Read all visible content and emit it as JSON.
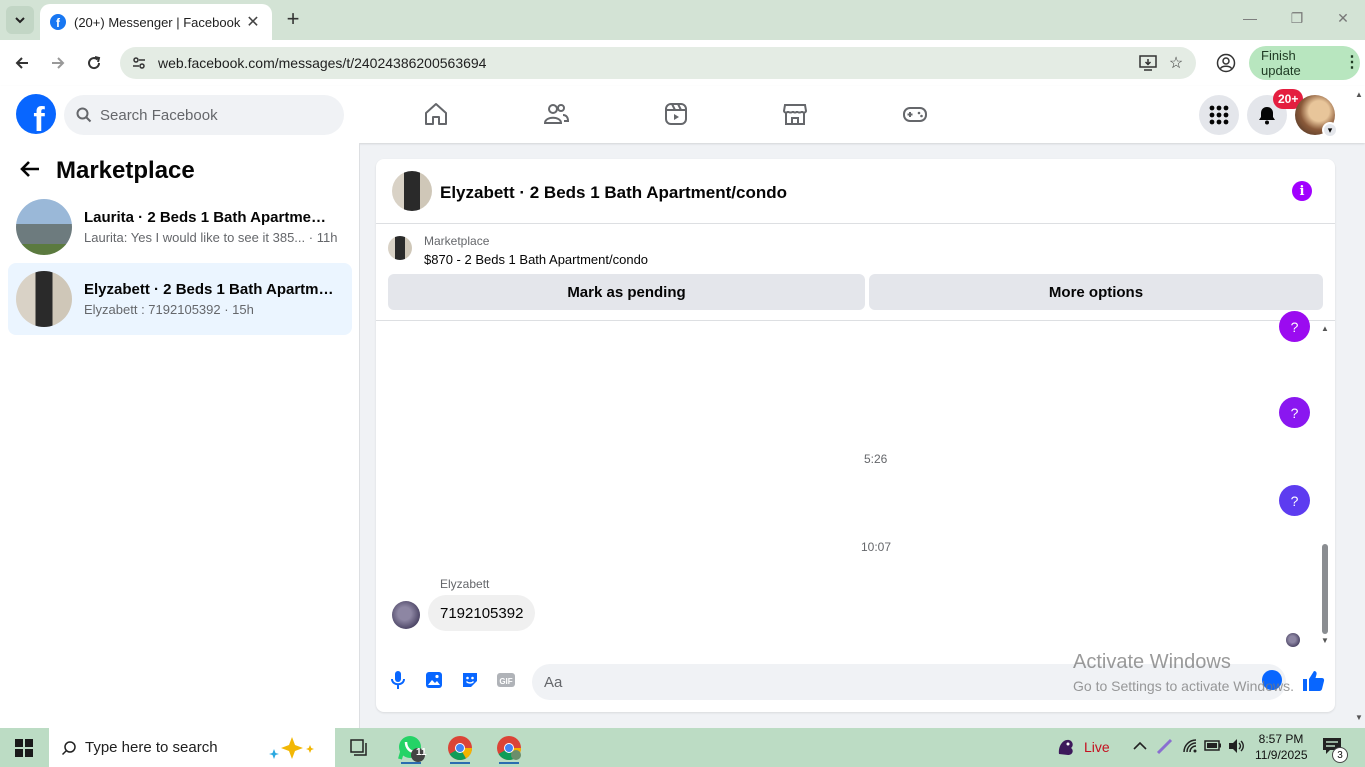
{
  "browser": {
    "tab_title": "(20+) Messenger | Facebook",
    "url": "web.facebook.com/messages/t/24024386200563694",
    "finish_update": "Finish update"
  },
  "fb_header": {
    "search_placeholder": "Search Facebook",
    "notification_badge": "20+",
    "nav": [
      "home-icon",
      "friends-icon",
      "video-icon",
      "marketplace-icon",
      "gaming-icon"
    ]
  },
  "sidebar": {
    "title": "Marketplace",
    "conversations": [
      {
        "name": "Laurita · 2 Beds 1 Bath Apartment/...",
        "preview": "Laurita: Yes I would like to see it 385... · 11h",
        "active": false
      },
      {
        "name": "Elyzabett · 2 Beds 1 Bath Apartme...",
        "preview": "Elyzabett : 7192105392 · 15h",
        "active": true
      }
    ]
  },
  "chat": {
    "title": "Elyzabett · 2 Beds 1 Bath Apartment/condo",
    "listing_source": "Marketplace",
    "listing_title": "$870 - 2 Beds 1 Bath Apartment/condo",
    "mark_pending": "Mark as pending",
    "more_options": "More options",
    "bubbles": [
      {
        "text": "?",
        "color": "#9b0bf0"
      },
      {
        "text": "?",
        "color": "#8a17f0"
      },
      {
        "text": "?",
        "color": "#5d3cf0"
      }
    ],
    "timestamps": [
      "5:26",
      "10:07"
    ],
    "sender_name": "Elyzabett",
    "incoming_message": "7192105392",
    "composer_placeholder": "Aa"
  },
  "watermark": {
    "line1": "Activate Windows",
    "line2": "Go to Settings to activate Windows."
  },
  "taskbar": {
    "search_placeholder": "Type here to search",
    "whatsapp_badge": "11",
    "live_label": "Live",
    "time": "8:57 PM",
    "date": "11/9/2025",
    "notification_count": "3"
  }
}
